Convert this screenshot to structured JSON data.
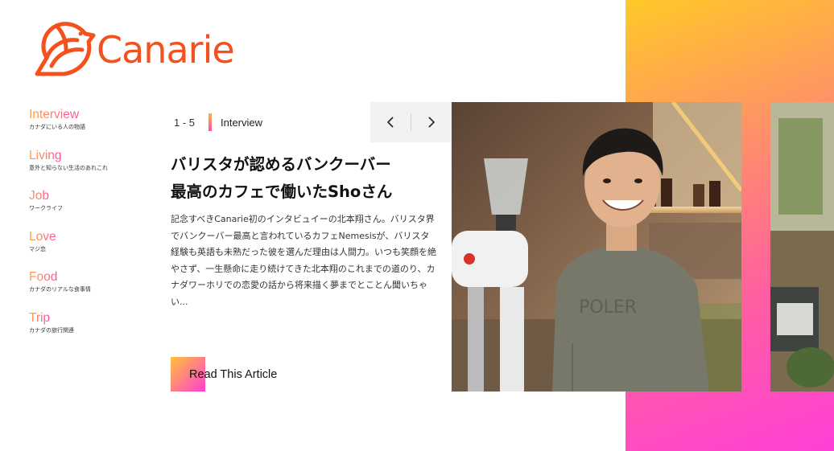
{
  "brand": {
    "name": "Canarie",
    "logo_icon": "bird-icon",
    "color": "#f4511e"
  },
  "nav": {
    "items": [
      {
        "label": "Interview",
        "sub": "カナダにいる人の物語"
      },
      {
        "label": "Living",
        "sub": "意外と知らない生活のあれこれ"
      },
      {
        "label": "Job",
        "sub": "ワークライフ"
      },
      {
        "label": "Love",
        "sub": "マジ恋"
      },
      {
        "label": "Food",
        "sub": "カナダのリアルな食事情"
      },
      {
        "label": "Trip",
        "sub": "カナダの旅行関連"
      }
    ]
  },
  "slider": {
    "counter": "1 - 5",
    "category": "Interview",
    "prev_icon": "chevron-left-icon",
    "next_icon": "chevron-right-icon"
  },
  "article": {
    "title_line1": "バリスタが認めるバンクーバー",
    "title_line2": "最高のカフェで働いたShoさん",
    "excerpt": "記念すべきCanarie初のインタビュイーの北本翔さん。バリスタ界でバンクーバー最高と言われているカフェNemesisが、バリスタ経験も英語も未熟だった彼を選んだ理由は人間力。いつも笑顔を絶やさず、一生懸命に走り続けてきた北本翔のこれまでの道のり、カナダワーホリでの恋愛の話から将来描く夢までとことん聞いちゃい...",
    "cta": "Read This Article",
    "sweatshirt_text": "POLER"
  },
  "colors": {
    "accent_orange": "#ffa53a",
    "accent_pink": "#ff4fa8",
    "gradient_yellow": "#ffc928",
    "gradient_magenta": "#ff3fd8"
  }
}
